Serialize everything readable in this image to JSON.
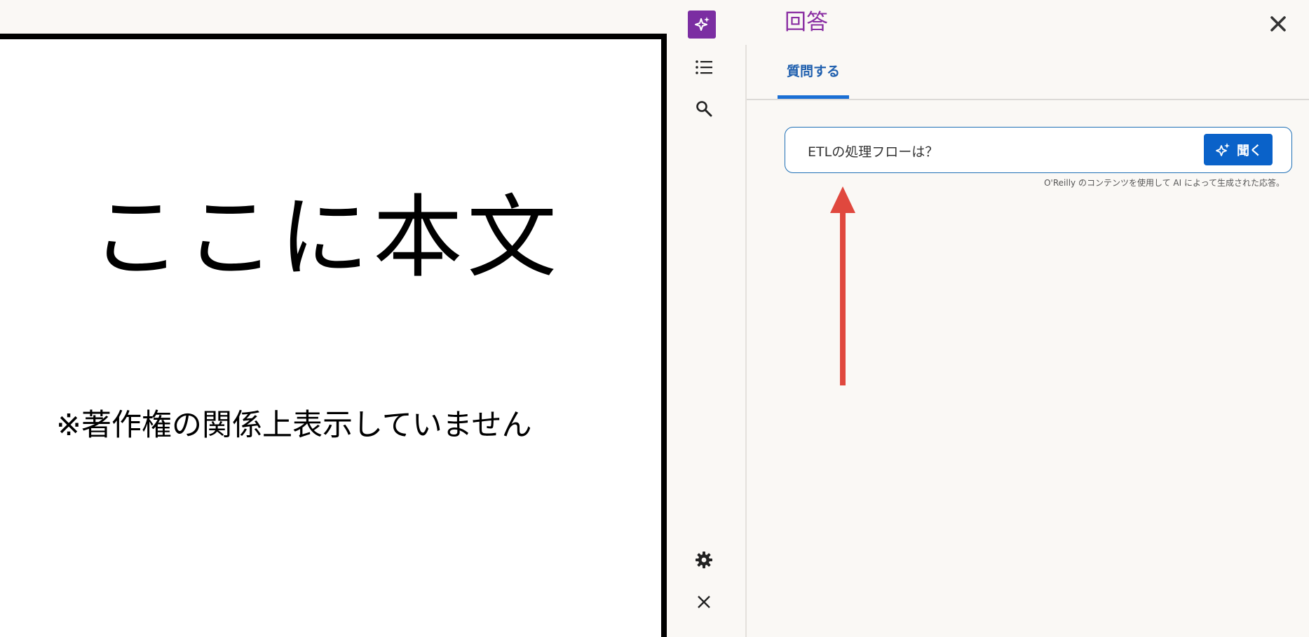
{
  "content": {
    "placeholder_text": "ここに本文",
    "note_text": "※著作権の関係上表示していません"
  },
  "rail": {
    "items": [
      {
        "icon": "sparkle-icon",
        "label": "AI"
      },
      {
        "icon": "list-icon",
        "label": "table-of-contents"
      },
      {
        "icon": "search-icon",
        "label": "search"
      },
      {
        "icon": "gear-icon",
        "label": "settings"
      },
      {
        "icon": "close-icon",
        "label": "close"
      }
    ]
  },
  "answer_panel": {
    "title": "回答",
    "tabs": [
      {
        "label": "質問する",
        "active": true
      }
    ],
    "ask": {
      "input_value": "ETLの処理フローは？",
      "button_label": "聞く"
    },
    "disclaimer": "O'Reilly のコンテンツを使用して AI によって生成された応答。"
  },
  "colors": {
    "brand_purple": "#8a2ea3",
    "accent_blue": "#0a62c9",
    "annotation_red": "#e0483e"
  }
}
